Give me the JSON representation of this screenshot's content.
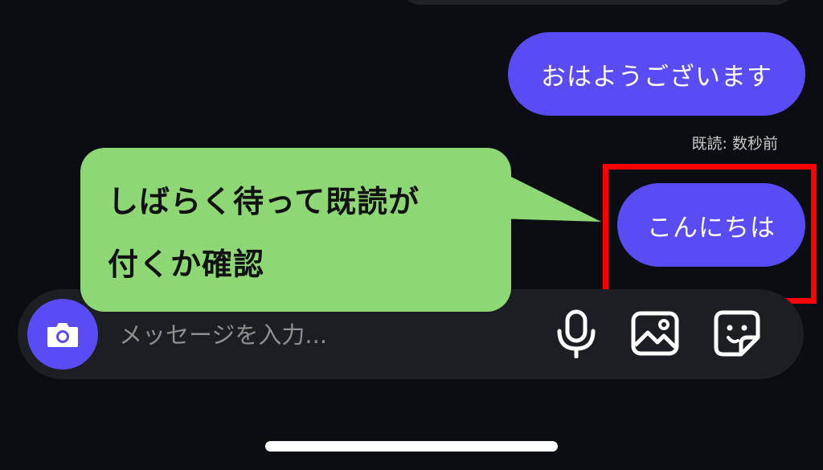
{
  "messages": [
    {
      "text": "おはようございます"
    },
    {
      "text": "こんにちは"
    }
  ],
  "read_receipt": "既読: 数秒前",
  "input": {
    "placeholder": "メッセージを入力..."
  },
  "icons": {
    "camera": "camera-icon",
    "mic": "mic-icon",
    "image": "image-icon",
    "sticker": "sticker-icon"
  },
  "annotation": {
    "line1": "しばらく待って既読が",
    "line2": "付くか確認"
  },
  "colors": {
    "background": "#0b0d12",
    "bubble": "#5a4cf5",
    "callout": "#8dd875",
    "highlight": "#ff0000"
  }
}
